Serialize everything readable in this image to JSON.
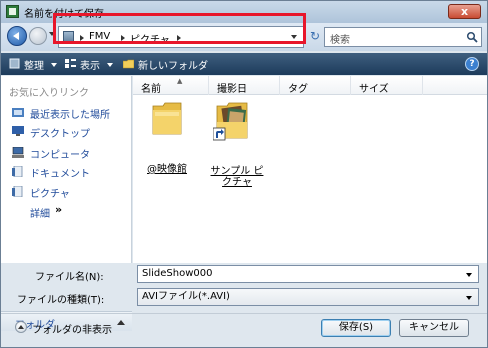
{
  "window": {
    "title": "名前を付けて保存",
    "close_label": "x"
  },
  "address": {
    "crumbs": [
      "FMV",
      "ピクチャ"
    ],
    "search_placeholder": "検索"
  },
  "toolbar": {
    "organize": "整理",
    "views": "表示",
    "new_folder": "新しいフォルダ",
    "help": "?"
  },
  "nav": {
    "heading": "お気に入りリンク",
    "items": [
      {
        "label": "最近表示した場所",
        "icon": "recent-places-icon"
      },
      {
        "label": "デスクトップ",
        "icon": "desktop-icon"
      },
      {
        "label": "コンピュータ",
        "icon": "computer-icon"
      },
      {
        "label": "ドキュメント",
        "icon": "documents-icon"
      },
      {
        "label": "ピクチャ",
        "icon": "pictures-icon"
      }
    ],
    "detail_label": "詳細",
    "detail_chevron": "»",
    "folders_label": "フォルダ"
  },
  "columns": [
    "名前",
    "撮影日",
    "タグ",
    "サイズ"
  ],
  "files": [
    {
      "name": "@映像館",
      "icon": "folder-icon"
    },
    {
      "name": "サンプル ピクチャ",
      "icon": "shortcut-folder-icon"
    }
  ],
  "form": {
    "filename_label": "ファイル名(N):",
    "filename_value": "SlideShow000",
    "filetype_label": "ファイルの種類(T):",
    "filetype_value": "AVIファイル(*.AVI)"
  },
  "footer": {
    "hide_folders": "フォルダの非表示",
    "save": "保存(S)",
    "cancel": "キャンセル"
  }
}
